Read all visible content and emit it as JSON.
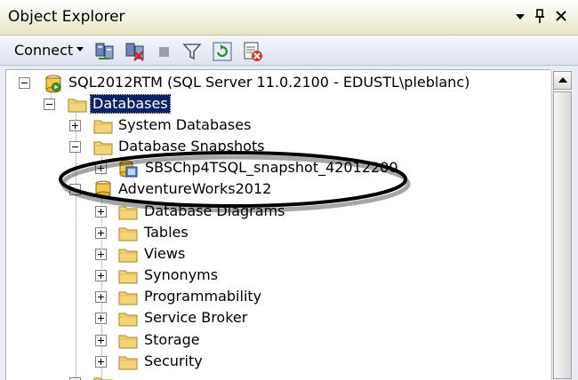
{
  "window": {
    "title": "Object Explorer",
    "pin_glyph": "▾",
    "dock_glyph": "ꟷ",
    "close_glyph": "✕"
  },
  "toolbar": {
    "connect_label": "Connect",
    "icons": [
      "connect-object-explorer-icon",
      "disconnect-icon",
      "stop-icon",
      "filter-icon",
      "refresh-icon",
      "activity-monitor-icon"
    ]
  },
  "tree": {
    "server": "SQL2012RTM (SQL Server 11.0.2100 - EDUSTL\\pleblanc)",
    "databases": "Databases",
    "system_databases": "System Databases",
    "database_snapshots": "Database Snapshots",
    "snapshot": "SBSChp4TSQL_snapshot_42012200",
    "adventureworks": "AdventureWorks2012",
    "children": [
      "Database Diagrams",
      "Tables",
      "Views",
      "Synonyms",
      "Programmability",
      "Service Broker",
      "Storage",
      "Security"
    ]
  },
  "colors": {
    "selection": "#0a246a",
    "folder": "#f4d47a",
    "title_bar": "#f3f1e1"
  }
}
